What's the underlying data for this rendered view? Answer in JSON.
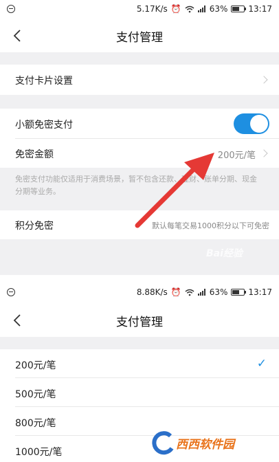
{
  "screen1": {
    "status": {
      "speed": "5.17K/s",
      "battery": "63%",
      "time": "13:17"
    },
    "title": "支付管理",
    "card_settings": {
      "label": "支付卡片设置"
    },
    "small_free_pay": {
      "label": "小额免密支付",
      "enabled": true
    },
    "free_amount": {
      "label": "免密金额",
      "value": "200元/笔"
    },
    "note": "免密支付功能仅适用于消费场景，暂不包含还款、理财、账单分期、现金分期等业务。",
    "points_free": {
      "label": "积分免密",
      "value": "默认每笔交易1000积分以下可免密"
    },
    "watermark": "Bai经验"
  },
  "screen2": {
    "status": {
      "speed": "8.88K/s",
      "battery": "63%",
      "time": "13:17"
    },
    "title": "支付管理",
    "options": [
      "200元/笔",
      "500元/笔",
      "800元/笔",
      "1000元/笔"
    ],
    "selected_index": 0,
    "check_mark": "✓",
    "watermark": "西西软件园"
  },
  "colors": {
    "accent": "#1e8fe1",
    "arrow": "#e53935",
    "gap": "#f0f0f2"
  }
}
